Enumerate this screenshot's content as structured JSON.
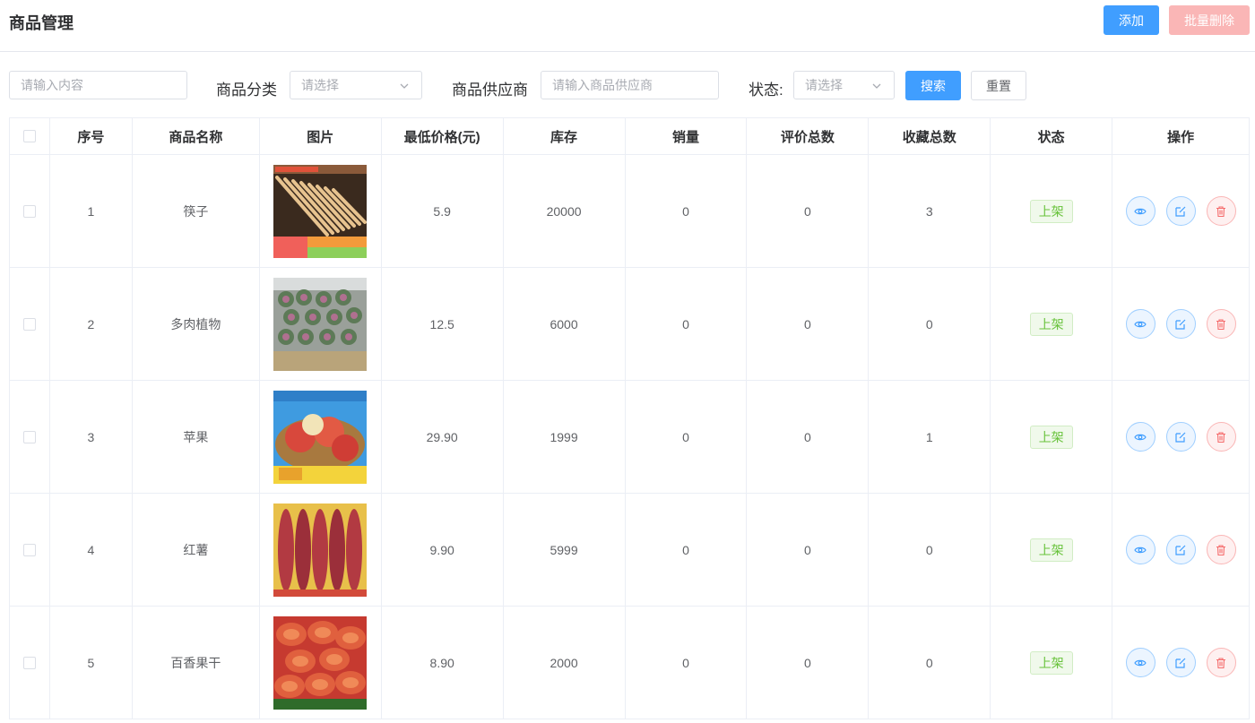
{
  "header": {
    "title": "商品管理",
    "add_label": "添加",
    "batch_delete_label": "批量删除"
  },
  "filters": {
    "keyword_placeholder": "请输入内容",
    "category_label": "商品分类",
    "category_placeholder": "请选择",
    "supplier_label": "商品供应商",
    "supplier_placeholder": "请输入商品供应商",
    "status_label": "状态:",
    "status_placeholder": "请选择",
    "search_label": "搜索",
    "reset_label": "重置"
  },
  "table": {
    "columns": [
      "序号",
      "商品名称",
      "图片",
      "最低价格(元)",
      "库存",
      "销量",
      "评价总数",
      "收藏总数",
      "状态",
      "操作"
    ],
    "rows": [
      {
        "index": "1",
        "name": "筷子",
        "price": "5.9",
        "stock": "20000",
        "sales": "0",
        "reviews": "0",
        "favorites": "3",
        "status": "上架",
        "thumb": "chopsticks"
      },
      {
        "index": "2",
        "name": "多肉植物",
        "price": "12.5",
        "stock": "6000",
        "sales": "0",
        "reviews": "0",
        "favorites": "0",
        "status": "上架",
        "thumb": "succulents"
      },
      {
        "index": "3",
        "name": "苹果",
        "price": "29.90",
        "stock": "1999",
        "sales": "0",
        "reviews": "0",
        "favorites": "1",
        "status": "上架",
        "thumb": "apples"
      },
      {
        "index": "4",
        "name": "红薯",
        "price": "9.90",
        "stock": "5999",
        "sales": "0",
        "reviews": "0",
        "favorites": "0",
        "status": "上架",
        "thumb": "sweet-potato"
      },
      {
        "index": "5",
        "name": "百香果干",
        "price": "8.90",
        "stock": "2000",
        "sales": "0",
        "reviews": "0",
        "favorites": "0",
        "status": "上架",
        "thumb": "dried-fruit"
      }
    ]
  },
  "icons": {
    "view": "eye-icon",
    "edit": "edit-icon",
    "delete": "trash-icon",
    "dropdown": "chevron-down-icon"
  },
  "colors": {
    "primary": "#409eff",
    "danger_light": "#fab6b6",
    "success": "#67c23a"
  }
}
